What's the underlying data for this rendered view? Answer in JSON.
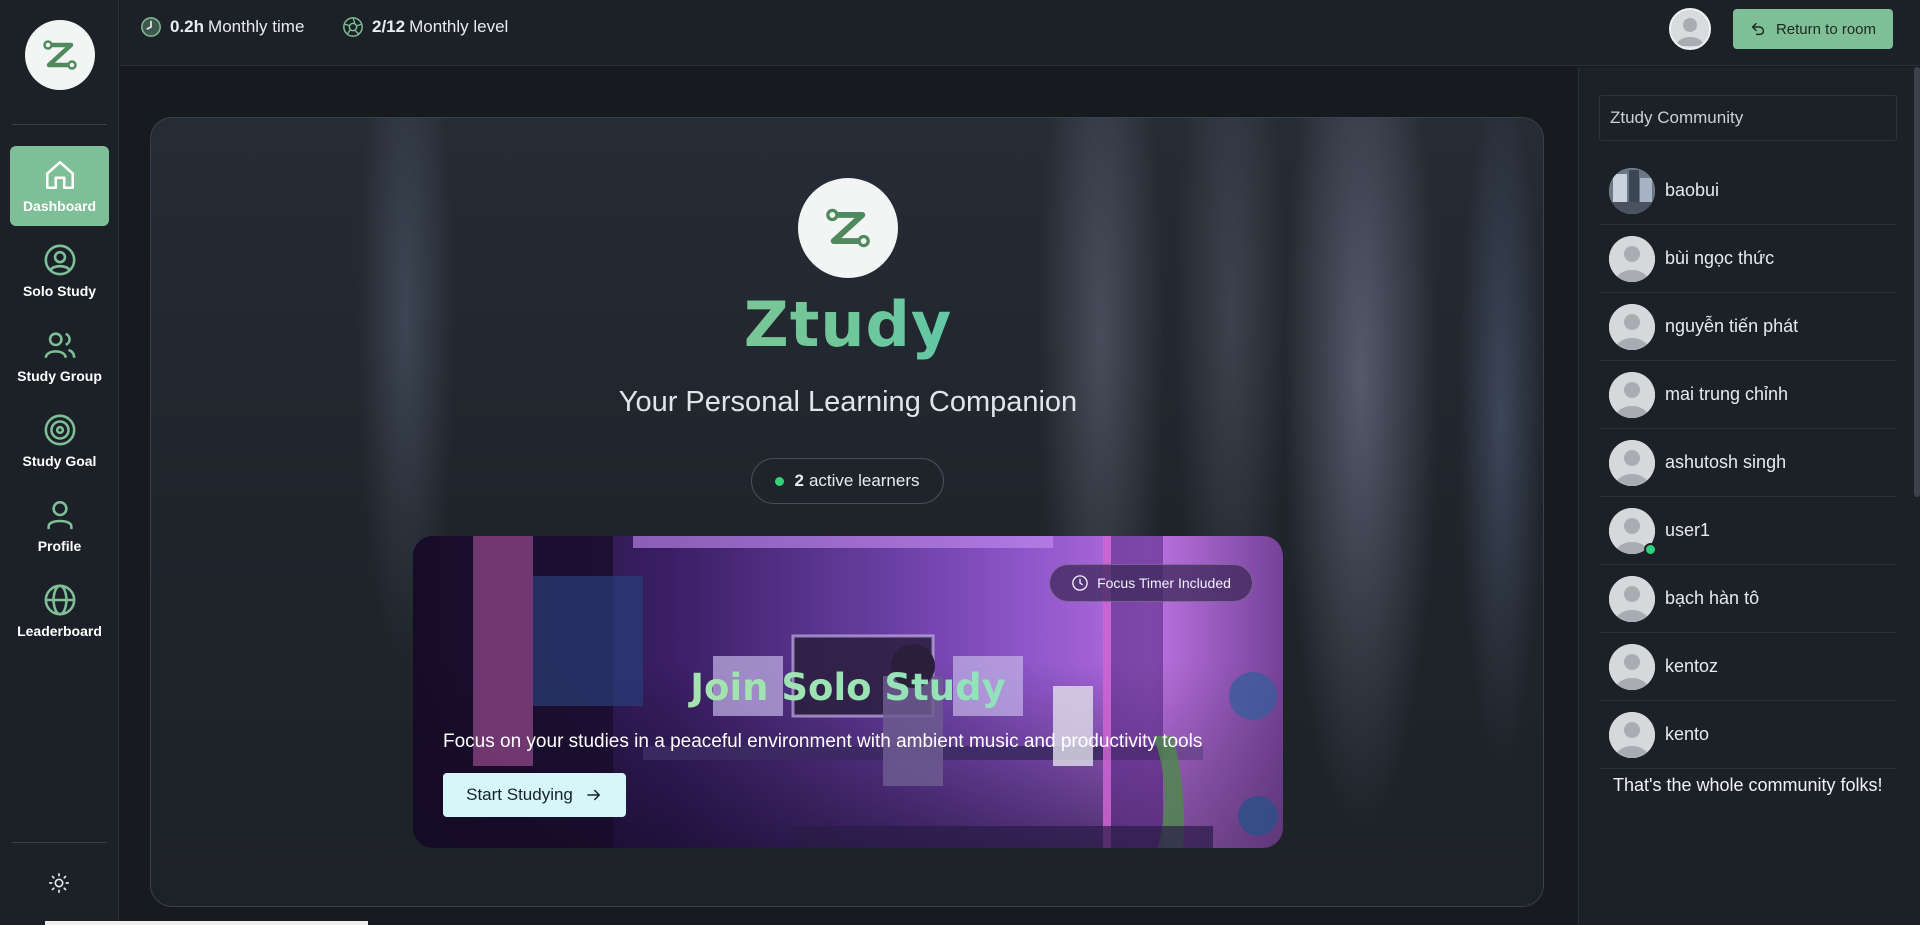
{
  "sidebar": {
    "logo_icon": "ztudy-logo-icon",
    "items": [
      {
        "label": "Dashboard",
        "icon": "home-icon",
        "active": true
      },
      {
        "label": "Solo Study",
        "icon": "user-circle-icon",
        "active": false
      },
      {
        "label": "Study Group",
        "icon": "users-icon",
        "active": false
      },
      {
        "label": "Study Goal",
        "icon": "target-icon",
        "active": false
      },
      {
        "label": "Profile",
        "icon": "user-icon",
        "active": false
      },
      {
        "label": "Leaderboard",
        "icon": "globe-icon",
        "active": false
      }
    ],
    "theme_icon": "sun-icon"
  },
  "topbar": {
    "monthly_time_value": "0.2h",
    "monthly_time_label": "Monthly time",
    "monthly_level_value": "2/12",
    "monthly_level_label": "Monthly level",
    "return_label": "Return to room"
  },
  "hero": {
    "title": "Ztudy",
    "subtitle": "Your Personal Learning Companion",
    "active_count": "2",
    "active_label": "active learners",
    "card": {
      "badge": "Focus Timer Included",
      "title": "Join Solo Study",
      "description": "Focus on your studies in a peaceful environment with ambient music and productivity tools",
      "button": "Start Studying"
    }
  },
  "community": {
    "title": "Ztudy Community",
    "members": [
      {
        "name": "baobui",
        "photo": true,
        "online": false
      },
      {
        "name": "bùi ngọc thức",
        "photo": false,
        "online": false
      },
      {
        "name": "nguyễn tiến phát",
        "photo": false,
        "online": false
      },
      {
        "name": "mai trung chỉnh",
        "photo": false,
        "online": false
      },
      {
        "name": "ashutosh singh",
        "photo": false,
        "online": false
      },
      {
        "name": "user1",
        "photo": false,
        "online": true
      },
      {
        "name": "bạch hàn tô",
        "photo": false,
        "online": false
      },
      {
        "name": "kentoz",
        "photo": false,
        "online": false
      },
      {
        "name": "kento",
        "photo": false,
        "online": false
      }
    ],
    "end_text": "That's the whole community folks!"
  },
  "colors": {
    "accent": "#7fbf98",
    "online": "#2fd27d",
    "title_gradient_start": "#b4c27a",
    "title_gradient_end": "#1ed0e8"
  }
}
